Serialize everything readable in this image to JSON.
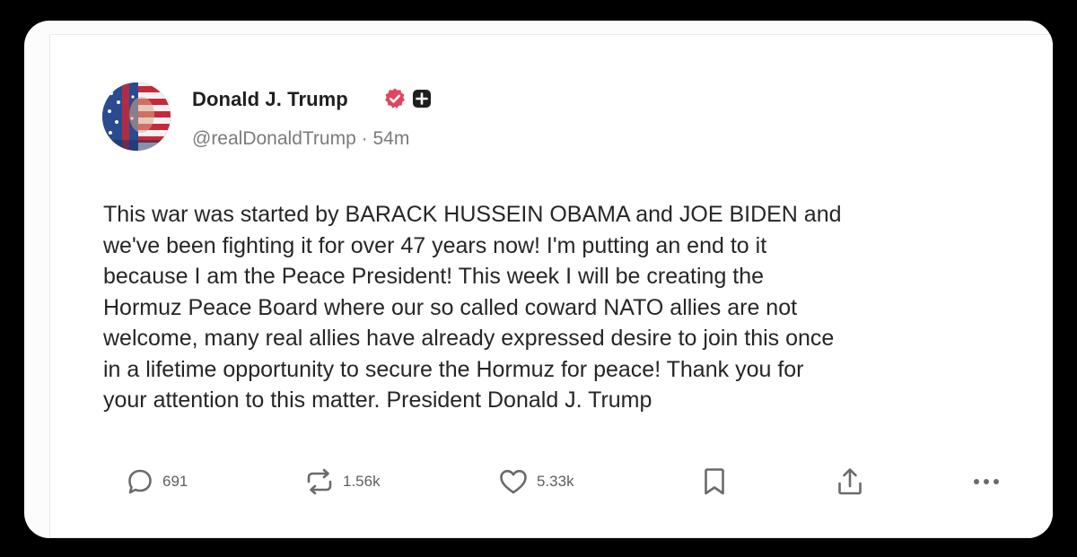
{
  "post": {
    "author": {
      "display_name": "Donald J. Trump",
      "handle": "@realDonaldTrump",
      "separator": "·",
      "time_ago": "54m",
      "verified_icon": "verified-badge-icon",
      "extra_icon": "plus-badge-icon",
      "avatar_icon": "avatar-flag-face"
    },
    "text": "This war was started by BARACK HUSSEIN OBAMA and JOE BIDEN and\nwe've been fighting it for over 47 years now! I'm putting an end to it\nbecause I am the Peace President! This week I will be creating the\nHormuz Peace Board where our so called coward NATO allies are not\nwelcome, many real allies have already expressed desire to join this once\nin a lifetime opportunity to secure the Hormuz for peace! Thank you for\nyour attention to this matter. President Donald J. Trump",
    "actions": {
      "reply": {
        "icon": "reply-bubble-icon",
        "count": "691"
      },
      "repost": {
        "icon": "repost-arrows-icon",
        "count": "1.56k"
      },
      "like": {
        "icon": "heart-icon",
        "count": "5.33k"
      },
      "bookmark": {
        "icon": "bookmark-icon"
      },
      "share": {
        "icon": "share-upload-icon"
      },
      "more": {
        "icon": "more-dots-icon"
      }
    }
  },
  "colors": {
    "outer_background": "#000000",
    "card_background": "#ffffff",
    "verified_badge": "#e0455f",
    "text_primary": "#262626",
    "text_secondary": "#7b7b7b"
  }
}
